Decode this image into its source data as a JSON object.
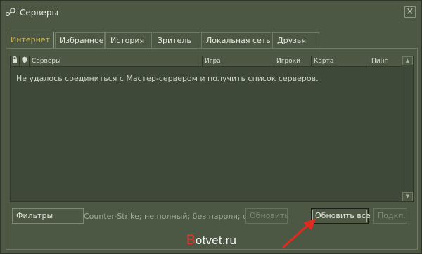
{
  "window": {
    "title": "Серверы",
    "close_glyph": "×"
  },
  "tabs": [
    {
      "label": "Интернет",
      "active": true
    },
    {
      "label": "Избранное",
      "active": false
    },
    {
      "label": "История",
      "active": false
    },
    {
      "label": "Зритель",
      "active": false
    },
    {
      "label": "Локальная сеть",
      "active": false
    },
    {
      "label": "Друзья",
      "active": false
    }
  ],
  "list": {
    "columns": {
      "lock_icon": "lock-icon",
      "shield_icon": "shield-icon",
      "servers": "Серверы",
      "game": "Игра",
      "players": "Игроки",
      "map": "Карта",
      "ping": "Пинг"
    },
    "empty_message": "Не удалось соединиться с Мастер-сервером и получить список серверов."
  },
  "bottom": {
    "filters_button": "Фильтры",
    "filter_description": "Counter-Strike; не полный; без пароля; d...",
    "refresh_button": "Обновить",
    "refresh_all_button": "Обновить все",
    "connect_button": "Подкл."
  },
  "watermark": {
    "first_letter": "B",
    "rest": "otvet.ru"
  },
  "colors": {
    "background": "#4c5844",
    "active_tab_text": "#c8b45a",
    "arrow": "#e02a1f"
  }
}
